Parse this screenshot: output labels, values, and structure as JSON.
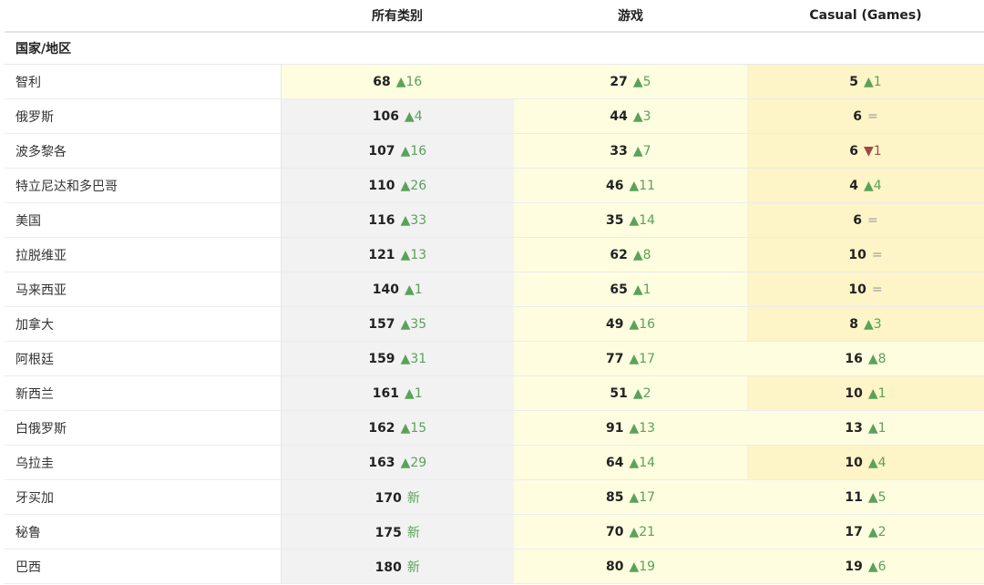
{
  "header": {
    "col_country": "",
    "col_all": "所有类别",
    "col_games": "游戏",
    "col_casual": "Casual (Games)"
  },
  "subheader": {
    "label": "国家/地区"
  },
  "colors": {
    "up": "#5aa25a",
    "down": "#a04848",
    "same": "#9a9a9a",
    "bg_gray": "#f2f2f2",
    "bg_light_yellow": "#fffde0",
    "bg_yellow": "#fdf4c7"
  },
  "rows": [
    {
      "country": "智利",
      "all": {
        "rank": "68",
        "chg": "▲16",
        "dir": "up",
        "bg": "y"
      },
      "games": {
        "rank": "27",
        "chg": "▲5",
        "dir": "up",
        "bg": "y"
      },
      "casual": {
        "rank": "5",
        "chg": "▲1",
        "dir": "up",
        "bg": "o"
      }
    },
    {
      "country": "俄罗斯",
      "all": {
        "rank": "106",
        "chg": "▲4",
        "dir": "up",
        "bg": "g"
      },
      "games": {
        "rank": "44",
        "chg": "▲3",
        "dir": "up",
        "bg": "y"
      },
      "casual": {
        "rank": "6",
        "chg": "=",
        "dir": "same",
        "bg": "o"
      }
    },
    {
      "country": "波多黎各",
      "all": {
        "rank": "107",
        "chg": "▲16",
        "dir": "up",
        "bg": "g"
      },
      "games": {
        "rank": "33",
        "chg": "▲7",
        "dir": "up",
        "bg": "y"
      },
      "casual": {
        "rank": "6",
        "chg": "▼1",
        "dir": "down",
        "bg": "o"
      }
    },
    {
      "country": "特立尼达和多巴哥",
      "all": {
        "rank": "110",
        "chg": "▲26",
        "dir": "up",
        "bg": "g"
      },
      "games": {
        "rank": "46",
        "chg": "▲11",
        "dir": "up",
        "bg": "y"
      },
      "casual": {
        "rank": "4",
        "chg": "▲4",
        "dir": "up",
        "bg": "o"
      }
    },
    {
      "country": "美国",
      "all": {
        "rank": "116",
        "chg": "▲33",
        "dir": "up",
        "bg": "g"
      },
      "games": {
        "rank": "35",
        "chg": "▲14",
        "dir": "up",
        "bg": "y"
      },
      "casual": {
        "rank": "6",
        "chg": "=",
        "dir": "same",
        "bg": "o"
      }
    },
    {
      "country": "拉脱维亚",
      "all": {
        "rank": "121",
        "chg": "▲13",
        "dir": "up",
        "bg": "g"
      },
      "games": {
        "rank": "62",
        "chg": "▲8",
        "dir": "up",
        "bg": "y"
      },
      "casual": {
        "rank": "10",
        "chg": "=",
        "dir": "same",
        "bg": "o"
      }
    },
    {
      "country": "马来西亚",
      "all": {
        "rank": "140",
        "chg": "▲1",
        "dir": "up",
        "bg": "g"
      },
      "games": {
        "rank": "65",
        "chg": "▲1",
        "dir": "up",
        "bg": "y"
      },
      "casual": {
        "rank": "10",
        "chg": "=",
        "dir": "same",
        "bg": "o"
      }
    },
    {
      "country": "加拿大",
      "all": {
        "rank": "157",
        "chg": "▲35",
        "dir": "up",
        "bg": "g"
      },
      "games": {
        "rank": "49",
        "chg": "▲16",
        "dir": "up",
        "bg": "y"
      },
      "casual": {
        "rank": "8",
        "chg": "▲3",
        "dir": "up",
        "bg": "o"
      }
    },
    {
      "country": "阿根廷",
      "all": {
        "rank": "159",
        "chg": "▲31",
        "dir": "up",
        "bg": "g"
      },
      "games": {
        "rank": "77",
        "chg": "▲17",
        "dir": "up",
        "bg": "y"
      },
      "casual": {
        "rank": "16",
        "chg": "▲8",
        "dir": "up",
        "bg": "y"
      }
    },
    {
      "country": "新西兰",
      "all": {
        "rank": "161",
        "chg": "▲1",
        "dir": "up",
        "bg": "g"
      },
      "games": {
        "rank": "51",
        "chg": "▲2",
        "dir": "up",
        "bg": "y"
      },
      "casual": {
        "rank": "10",
        "chg": "▲1",
        "dir": "up",
        "bg": "o"
      }
    },
    {
      "country": "白俄罗斯",
      "all": {
        "rank": "162",
        "chg": "▲15",
        "dir": "up",
        "bg": "g"
      },
      "games": {
        "rank": "91",
        "chg": "▲13",
        "dir": "up",
        "bg": "y"
      },
      "casual": {
        "rank": "13",
        "chg": "▲1",
        "dir": "up",
        "bg": "y"
      }
    },
    {
      "country": "乌拉圭",
      "all": {
        "rank": "163",
        "chg": "▲29",
        "dir": "up",
        "bg": "g"
      },
      "games": {
        "rank": "64",
        "chg": "▲14",
        "dir": "up",
        "bg": "y"
      },
      "casual": {
        "rank": "10",
        "chg": "▲4",
        "dir": "up",
        "bg": "o"
      }
    },
    {
      "country": "牙买加",
      "all": {
        "rank": "170",
        "chg": "新",
        "dir": "new",
        "bg": "g"
      },
      "games": {
        "rank": "85",
        "chg": "▲17",
        "dir": "up",
        "bg": "y"
      },
      "casual": {
        "rank": "11",
        "chg": "▲5",
        "dir": "up",
        "bg": "y"
      }
    },
    {
      "country": "秘鲁",
      "all": {
        "rank": "175",
        "chg": "新",
        "dir": "new",
        "bg": "g"
      },
      "games": {
        "rank": "70",
        "chg": "▲21",
        "dir": "up",
        "bg": "y"
      },
      "casual": {
        "rank": "17",
        "chg": "▲2",
        "dir": "up",
        "bg": "y"
      }
    },
    {
      "country": "巴西",
      "all": {
        "rank": "180",
        "chg": "新",
        "dir": "new",
        "bg": "g"
      },
      "games": {
        "rank": "80",
        "chg": "▲19",
        "dir": "up",
        "bg": "y"
      },
      "casual": {
        "rank": "19",
        "chg": "▲6",
        "dir": "up",
        "bg": "y"
      }
    }
  ]
}
